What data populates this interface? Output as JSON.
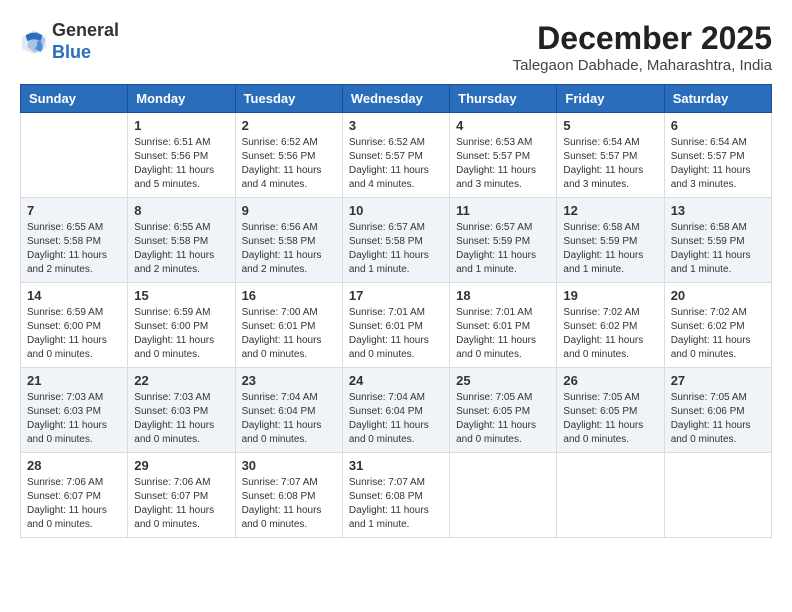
{
  "header": {
    "logo_line1": "General",
    "logo_line2": "Blue",
    "month_year": "December 2025",
    "location": "Talegaon Dabhade, Maharashtra, India"
  },
  "days_of_week": [
    "Sunday",
    "Monday",
    "Tuesday",
    "Wednesday",
    "Thursday",
    "Friday",
    "Saturday"
  ],
  "weeks": [
    [
      {
        "day": "",
        "sunrise": "",
        "sunset": "",
        "daylight": ""
      },
      {
        "day": "1",
        "sunrise": "Sunrise: 6:51 AM",
        "sunset": "Sunset: 5:56 PM",
        "daylight": "Daylight: 11 hours and 5 minutes."
      },
      {
        "day": "2",
        "sunrise": "Sunrise: 6:52 AM",
        "sunset": "Sunset: 5:56 PM",
        "daylight": "Daylight: 11 hours and 4 minutes."
      },
      {
        "day": "3",
        "sunrise": "Sunrise: 6:52 AM",
        "sunset": "Sunset: 5:57 PM",
        "daylight": "Daylight: 11 hours and 4 minutes."
      },
      {
        "day": "4",
        "sunrise": "Sunrise: 6:53 AM",
        "sunset": "Sunset: 5:57 PM",
        "daylight": "Daylight: 11 hours and 3 minutes."
      },
      {
        "day": "5",
        "sunrise": "Sunrise: 6:54 AM",
        "sunset": "Sunset: 5:57 PM",
        "daylight": "Daylight: 11 hours and 3 minutes."
      },
      {
        "day": "6",
        "sunrise": "Sunrise: 6:54 AM",
        "sunset": "Sunset: 5:57 PM",
        "daylight": "Daylight: 11 hours and 3 minutes."
      }
    ],
    [
      {
        "day": "7",
        "sunrise": "Sunrise: 6:55 AM",
        "sunset": "Sunset: 5:58 PM",
        "daylight": "Daylight: 11 hours and 2 minutes."
      },
      {
        "day": "8",
        "sunrise": "Sunrise: 6:55 AM",
        "sunset": "Sunset: 5:58 PM",
        "daylight": "Daylight: 11 hours and 2 minutes."
      },
      {
        "day": "9",
        "sunrise": "Sunrise: 6:56 AM",
        "sunset": "Sunset: 5:58 PM",
        "daylight": "Daylight: 11 hours and 2 minutes."
      },
      {
        "day": "10",
        "sunrise": "Sunrise: 6:57 AM",
        "sunset": "Sunset: 5:58 PM",
        "daylight": "Daylight: 11 hours and 1 minute."
      },
      {
        "day": "11",
        "sunrise": "Sunrise: 6:57 AM",
        "sunset": "Sunset: 5:59 PM",
        "daylight": "Daylight: 11 hours and 1 minute."
      },
      {
        "day": "12",
        "sunrise": "Sunrise: 6:58 AM",
        "sunset": "Sunset: 5:59 PM",
        "daylight": "Daylight: 11 hours and 1 minute."
      },
      {
        "day": "13",
        "sunrise": "Sunrise: 6:58 AM",
        "sunset": "Sunset: 5:59 PM",
        "daylight": "Daylight: 11 hours and 1 minute."
      }
    ],
    [
      {
        "day": "14",
        "sunrise": "Sunrise: 6:59 AM",
        "sunset": "Sunset: 6:00 PM",
        "daylight": "Daylight: 11 hours and 0 minutes."
      },
      {
        "day": "15",
        "sunrise": "Sunrise: 6:59 AM",
        "sunset": "Sunset: 6:00 PM",
        "daylight": "Daylight: 11 hours and 0 minutes."
      },
      {
        "day": "16",
        "sunrise": "Sunrise: 7:00 AM",
        "sunset": "Sunset: 6:01 PM",
        "daylight": "Daylight: 11 hours and 0 minutes."
      },
      {
        "day": "17",
        "sunrise": "Sunrise: 7:01 AM",
        "sunset": "Sunset: 6:01 PM",
        "daylight": "Daylight: 11 hours and 0 minutes."
      },
      {
        "day": "18",
        "sunrise": "Sunrise: 7:01 AM",
        "sunset": "Sunset: 6:01 PM",
        "daylight": "Daylight: 11 hours and 0 minutes."
      },
      {
        "day": "19",
        "sunrise": "Sunrise: 7:02 AM",
        "sunset": "Sunset: 6:02 PM",
        "daylight": "Daylight: 11 hours and 0 minutes."
      },
      {
        "day": "20",
        "sunrise": "Sunrise: 7:02 AM",
        "sunset": "Sunset: 6:02 PM",
        "daylight": "Daylight: 11 hours and 0 minutes."
      }
    ],
    [
      {
        "day": "21",
        "sunrise": "Sunrise: 7:03 AM",
        "sunset": "Sunset: 6:03 PM",
        "daylight": "Daylight: 11 hours and 0 minutes."
      },
      {
        "day": "22",
        "sunrise": "Sunrise: 7:03 AM",
        "sunset": "Sunset: 6:03 PM",
        "daylight": "Daylight: 11 hours and 0 minutes."
      },
      {
        "day": "23",
        "sunrise": "Sunrise: 7:04 AM",
        "sunset": "Sunset: 6:04 PM",
        "daylight": "Daylight: 11 hours and 0 minutes."
      },
      {
        "day": "24",
        "sunrise": "Sunrise: 7:04 AM",
        "sunset": "Sunset: 6:04 PM",
        "daylight": "Daylight: 11 hours and 0 minutes."
      },
      {
        "day": "25",
        "sunrise": "Sunrise: 7:05 AM",
        "sunset": "Sunset: 6:05 PM",
        "daylight": "Daylight: 11 hours and 0 minutes."
      },
      {
        "day": "26",
        "sunrise": "Sunrise: 7:05 AM",
        "sunset": "Sunset: 6:05 PM",
        "daylight": "Daylight: 11 hours and 0 minutes."
      },
      {
        "day": "27",
        "sunrise": "Sunrise: 7:05 AM",
        "sunset": "Sunset: 6:06 PM",
        "daylight": "Daylight: 11 hours and 0 minutes."
      }
    ],
    [
      {
        "day": "28",
        "sunrise": "Sunrise: 7:06 AM",
        "sunset": "Sunset: 6:07 PM",
        "daylight": "Daylight: 11 hours and 0 minutes."
      },
      {
        "day": "29",
        "sunrise": "Sunrise: 7:06 AM",
        "sunset": "Sunset: 6:07 PM",
        "daylight": "Daylight: 11 hours and 0 minutes."
      },
      {
        "day": "30",
        "sunrise": "Sunrise: 7:07 AM",
        "sunset": "Sunset: 6:08 PM",
        "daylight": "Daylight: 11 hours and 0 minutes."
      },
      {
        "day": "31",
        "sunrise": "Sunrise: 7:07 AM",
        "sunset": "Sunset: 6:08 PM",
        "daylight": "Daylight: 11 hours and 1 minute."
      },
      {
        "day": "",
        "sunrise": "",
        "sunset": "",
        "daylight": ""
      },
      {
        "day": "",
        "sunrise": "",
        "sunset": "",
        "daylight": ""
      },
      {
        "day": "",
        "sunrise": "",
        "sunset": "",
        "daylight": ""
      }
    ]
  ]
}
